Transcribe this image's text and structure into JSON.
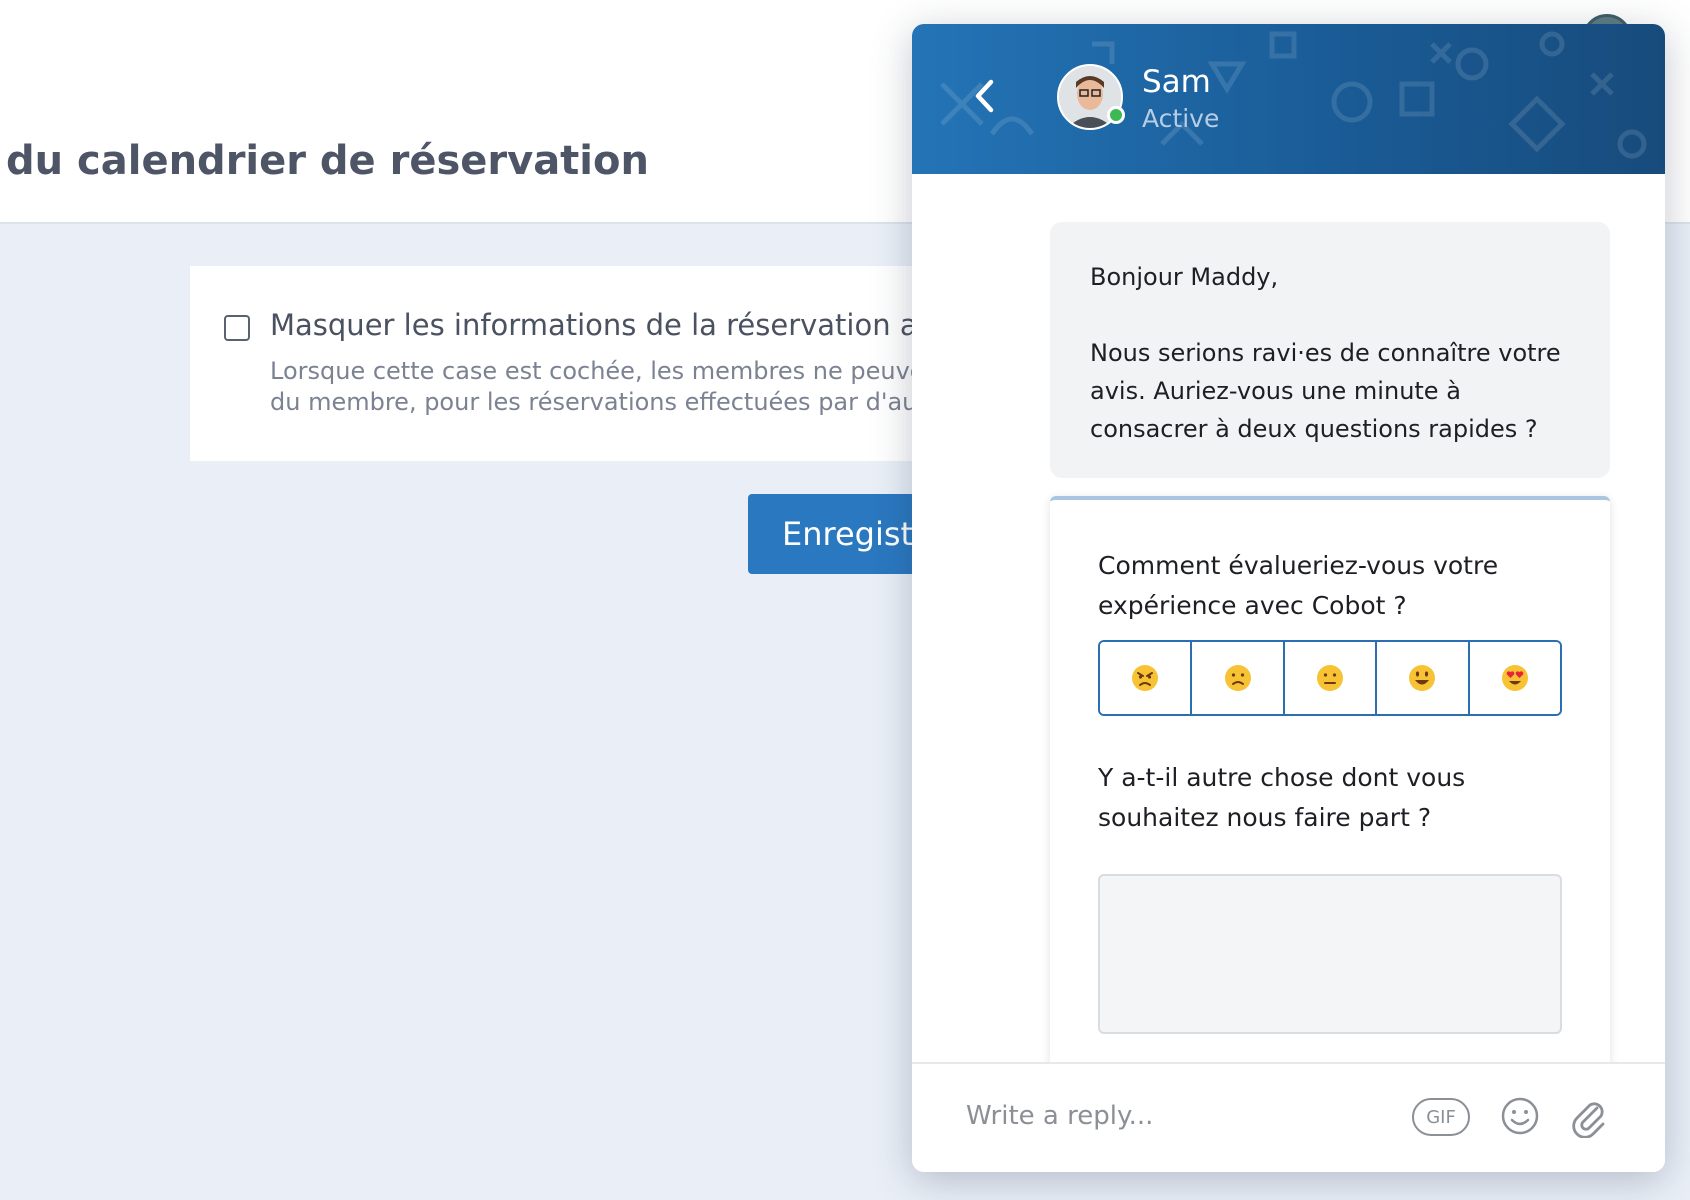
{
  "page": {
    "title": "du calendrier de réservation",
    "setting": {
      "label": "Masquer les informations de la réservation aux au",
      "description_line1": "Lorsque cette case est cochée, les membres ne peuvent p",
      "description_line2": "du membre, pour les réservations effectuées par d'autres"
    },
    "save_label": "Enregistrer"
  },
  "messenger": {
    "agent_name": "Sam",
    "agent_status": "Active",
    "message": {
      "greeting": "Bonjour Maddy,",
      "body": "Nous serions ravi·es de connaître votre avis. Auriez-vous une minute à consacrer à deux questions rapides ?"
    },
    "survey": {
      "question1": "Comment évalueriez-vous votre expérience avec Cobot ?",
      "ratings": [
        "😠",
        "🙁",
        "😐",
        "😃",
        "😍"
      ],
      "question2": "Y a-t-il autre chose dont vous souhaitez nous faire part ?"
    },
    "composer": {
      "placeholder": "Write a reply...",
      "gif_label": "GIF"
    }
  },
  "colors": {
    "primary": "#2a78c0",
    "header_dark": "#174b7c",
    "online": "#3cb954",
    "page_bg": "#eaeff7"
  }
}
